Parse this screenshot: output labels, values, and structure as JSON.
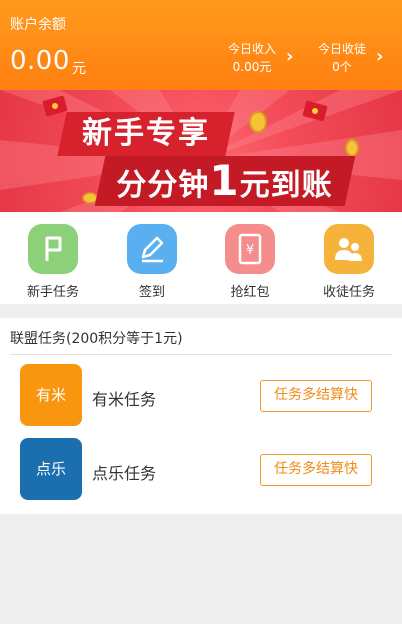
{
  "header": {
    "balance_label": "账户余额",
    "balance_amount": "0.00",
    "balance_unit": "元",
    "today_income_label": "今日收入",
    "today_income_value": "0.00元",
    "today_recruit_label": "今日收徒",
    "today_recruit_value": "0个"
  },
  "banner": {
    "line1": "新手专享",
    "line2_prefix": "分分钟",
    "line2_number": "1",
    "line2_suffix": "元到账"
  },
  "quick_actions": [
    {
      "label": "新手任务",
      "icon": "flag-icon",
      "color": "#8cd07a"
    },
    {
      "label": "签到",
      "icon": "pencil-icon",
      "color": "#5aaff0"
    },
    {
      "label": "抢红包",
      "icon": "red-envelope-icon",
      "icon_text": "¥",
      "color": "#f58d8d"
    },
    {
      "label": "收徒任务",
      "icon": "people-icon",
      "color": "#f6b33c"
    }
  ],
  "alliance": {
    "title": "联盟任务(200积分等于1元)",
    "tasks": [
      {
        "logo_text": "有米",
        "name": "有米任务",
        "button": "任务多结算快",
        "color": "#f8960f"
      },
      {
        "logo_text": "点乐",
        "name": "点乐任务",
        "button": "任务多结算快",
        "color": "#1c6fae"
      }
    ]
  }
}
